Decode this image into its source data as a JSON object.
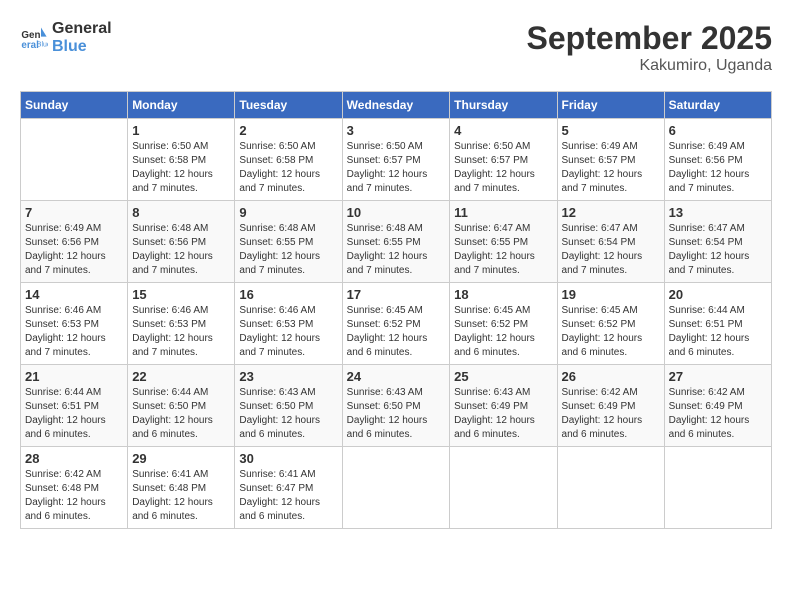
{
  "header": {
    "logo_line1": "General",
    "logo_line2": "Blue",
    "month": "September 2025",
    "location": "Kakumiro, Uganda"
  },
  "weekdays": [
    "Sunday",
    "Monday",
    "Tuesday",
    "Wednesday",
    "Thursday",
    "Friday",
    "Saturday"
  ],
  "weeks": [
    [
      {
        "day": "",
        "info": ""
      },
      {
        "day": "1",
        "info": "Sunrise: 6:50 AM\nSunset: 6:58 PM\nDaylight: 12 hours\nand 7 minutes."
      },
      {
        "day": "2",
        "info": "Sunrise: 6:50 AM\nSunset: 6:58 PM\nDaylight: 12 hours\nand 7 minutes."
      },
      {
        "day": "3",
        "info": "Sunrise: 6:50 AM\nSunset: 6:57 PM\nDaylight: 12 hours\nand 7 minutes."
      },
      {
        "day": "4",
        "info": "Sunrise: 6:50 AM\nSunset: 6:57 PM\nDaylight: 12 hours\nand 7 minutes."
      },
      {
        "day": "5",
        "info": "Sunrise: 6:49 AM\nSunset: 6:57 PM\nDaylight: 12 hours\nand 7 minutes."
      },
      {
        "day": "6",
        "info": "Sunrise: 6:49 AM\nSunset: 6:56 PM\nDaylight: 12 hours\nand 7 minutes."
      }
    ],
    [
      {
        "day": "7",
        "info": "Sunrise: 6:49 AM\nSunset: 6:56 PM\nDaylight: 12 hours\nand 7 minutes."
      },
      {
        "day": "8",
        "info": "Sunrise: 6:48 AM\nSunset: 6:56 PM\nDaylight: 12 hours\nand 7 minutes."
      },
      {
        "day": "9",
        "info": "Sunrise: 6:48 AM\nSunset: 6:55 PM\nDaylight: 12 hours\nand 7 minutes."
      },
      {
        "day": "10",
        "info": "Sunrise: 6:48 AM\nSunset: 6:55 PM\nDaylight: 12 hours\nand 7 minutes."
      },
      {
        "day": "11",
        "info": "Sunrise: 6:47 AM\nSunset: 6:55 PM\nDaylight: 12 hours\nand 7 minutes."
      },
      {
        "day": "12",
        "info": "Sunrise: 6:47 AM\nSunset: 6:54 PM\nDaylight: 12 hours\nand 7 minutes."
      },
      {
        "day": "13",
        "info": "Sunrise: 6:47 AM\nSunset: 6:54 PM\nDaylight: 12 hours\nand 7 minutes."
      }
    ],
    [
      {
        "day": "14",
        "info": "Sunrise: 6:46 AM\nSunset: 6:53 PM\nDaylight: 12 hours\nand 7 minutes."
      },
      {
        "day": "15",
        "info": "Sunrise: 6:46 AM\nSunset: 6:53 PM\nDaylight: 12 hours\nand 7 minutes."
      },
      {
        "day": "16",
        "info": "Sunrise: 6:46 AM\nSunset: 6:53 PM\nDaylight: 12 hours\nand 7 minutes."
      },
      {
        "day": "17",
        "info": "Sunrise: 6:45 AM\nSunset: 6:52 PM\nDaylight: 12 hours\nand 6 minutes."
      },
      {
        "day": "18",
        "info": "Sunrise: 6:45 AM\nSunset: 6:52 PM\nDaylight: 12 hours\nand 6 minutes."
      },
      {
        "day": "19",
        "info": "Sunrise: 6:45 AM\nSunset: 6:52 PM\nDaylight: 12 hours\nand 6 minutes."
      },
      {
        "day": "20",
        "info": "Sunrise: 6:44 AM\nSunset: 6:51 PM\nDaylight: 12 hours\nand 6 minutes."
      }
    ],
    [
      {
        "day": "21",
        "info": "Sunrise: 6:44 AM\nSunset: 6:51 PM\nDaylight: 12 hours\nand 6 minutes."
      },
      {
        "day": "22",
        "info": "Sunrise: 6:44 AM\nSunset: 6:50 PM\nDaylight: 12 hours\nand 6 minutes."
      },
      {
        "day": "23",
        "info": "Sunrise: 6:43 AM\nSunset: 6:50 PM\nDaylight: 12 hours\nand 6 minutes."
      },
      {
        "day": "24",
        "info": "Sunrise: 6:43 AM\nSunset: 6:50 PM\nDaylight: 12 hours\nand 6 minutes."
      },
      {
        "day": "25",
        "info": "Sunrise: 6:43 AM\nSunset: 6:49 PM\nDaylight: 12 hours\nand 6 minutes."
      },
      {
        "day": "26",
        "info": "Sunrise: 6:42 AM\nSunset: 6:49 PM\nDaylight: 12 hours\nand 6 minutes."
      },
      {
        "day": "27",
        "info": "Sunrise: 6:42 AM\nSunset: 6:49 PM\nDaylight: 12 hours\nand 6 minutes."
      }
    ],
    [
      {
        "day": "28",
        "info": "Sunrise: 6:42 AM\nSunset: 6:48 PM\nDaylight: 12 hours\nand 6 minutes."
      },
      {
        "day": "29",
        "info": "Sunrise: 6:41 AM\nSunset: 6:48 PM\nDaylight: 12 hours\nand 6 minutes."
      },
      {
        "day": "30",
        "info": "Sunrise: 6:41 AM\nSunset: 6:47 PM\nDaylight: 12 hours\nand 6 minutes."
      },
      {
        "day": "",
        "info": ""
      },
      {
        "day": "",
        "info": ""
      },
      {
        "day": "",
        "info": ""
      },
      {
        "day": "",
        "info": ""
      }
    ]
  ]
}
